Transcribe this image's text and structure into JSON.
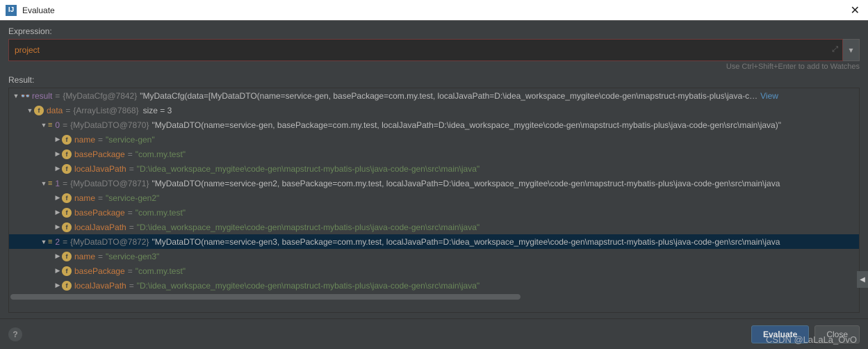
{
  "window": {
    "title": "Evaluate"
  },
  "labels": {
    "expression": "Expression:",
    "result": "Result:"
  },
  "expression": {
    "value": "project"
  },
  "hint": "Use Ctrl+Shift+Enter to add to Watches",
  "buttons": {
    "evaluate": "Evaluate",
    "close": "Close",
    "help": "?"
  },
  "tree": {
    "root": {
      "name": "result",
      "type": "{MyDataCfg@7842}",
      "value": "\"MyDataCfg(data=[MyDataDTO(name=service-gen, basePackage=com.my.test, localJavaPath=D:\\idea_workspace_mygitee\\code-gen\\mapstruct-mybatis-plus\\java-c…",
      "view": "View"
    },
    "data": {
      "name": "data",
      "type": "{ArrayList@7868}",
      "size": "size = 3"
    },
    "items": [
      {
        "idx": "0",
        "type": "{MyDataDTO@7870}",
        "value": "\"MyDataDTO(name=service-gen, basePackage=com.my.test, localJavaPath=D:\\idea_workspace_mygitee\\code-gen\\mapstruct-mybatis-plus\\java-code-gen\\src\\main\\java)\"",
        "fields": {
          "name": "\"service-gen\"",
          "basePackage": "\"com.my.test\"",
          "localJavaPath": "\"D:\\idea_workspace_mygitee\\code-gen\\mapstruct-mybatis-plus\\java-code-gen\\src\\main\\java\""
        }
      },
      {
        "idx": "1",
        "type": "{MyDataDTO@7871}",
        "value": "\"MyDataDTO(name=service-gen2, basePackage=com.my.test, localJavaPath=D:\\idea_workspace_mygitee\\code-gen\\mapstruct-mybatis-plus\\java-code-gen\\src\\main\\java",
        "fields": {
          "name": "\"service-gen2\"",
          "basePackage": "\"com.my.test\"",
          "localJavaPath": "\"D:\\idea_workspace_mygitee\\code-gen\\mapstruct-mybatis-plus\\java-code-gen\\src\\main\\java\""
        }
      },
      {
        "idx": "2",
        "type": "{MyDataDTO@7872}",
        "value": "\"MyDataDTO(name=service-gen3, basePackage=com.my.test, localJavaPath=D:\\idea_workspace_mygitee\\code-gen\\mapstruct-mybatis-plus\\java-code-gen\\src\\main\\java",
        "fields": {
          "name": "\"service-gen3\"",
          "basePackage": "\"com.my.test\"",
          "localJavaPath": "\"D:\\idea_workspace_mygitee\\code-gen\\mapstruct-mybatis-plus\\java-code-gen\\src\\main\\java\""
        }
      }
    ],
    "fieldLabels": {
      "name": "name",
      "basePackage": "basePackage",
      "localJavaPath": "localJavaPath"
    }
  },
  "watermark": "CSDN @LaLaLa_OvO"
}
